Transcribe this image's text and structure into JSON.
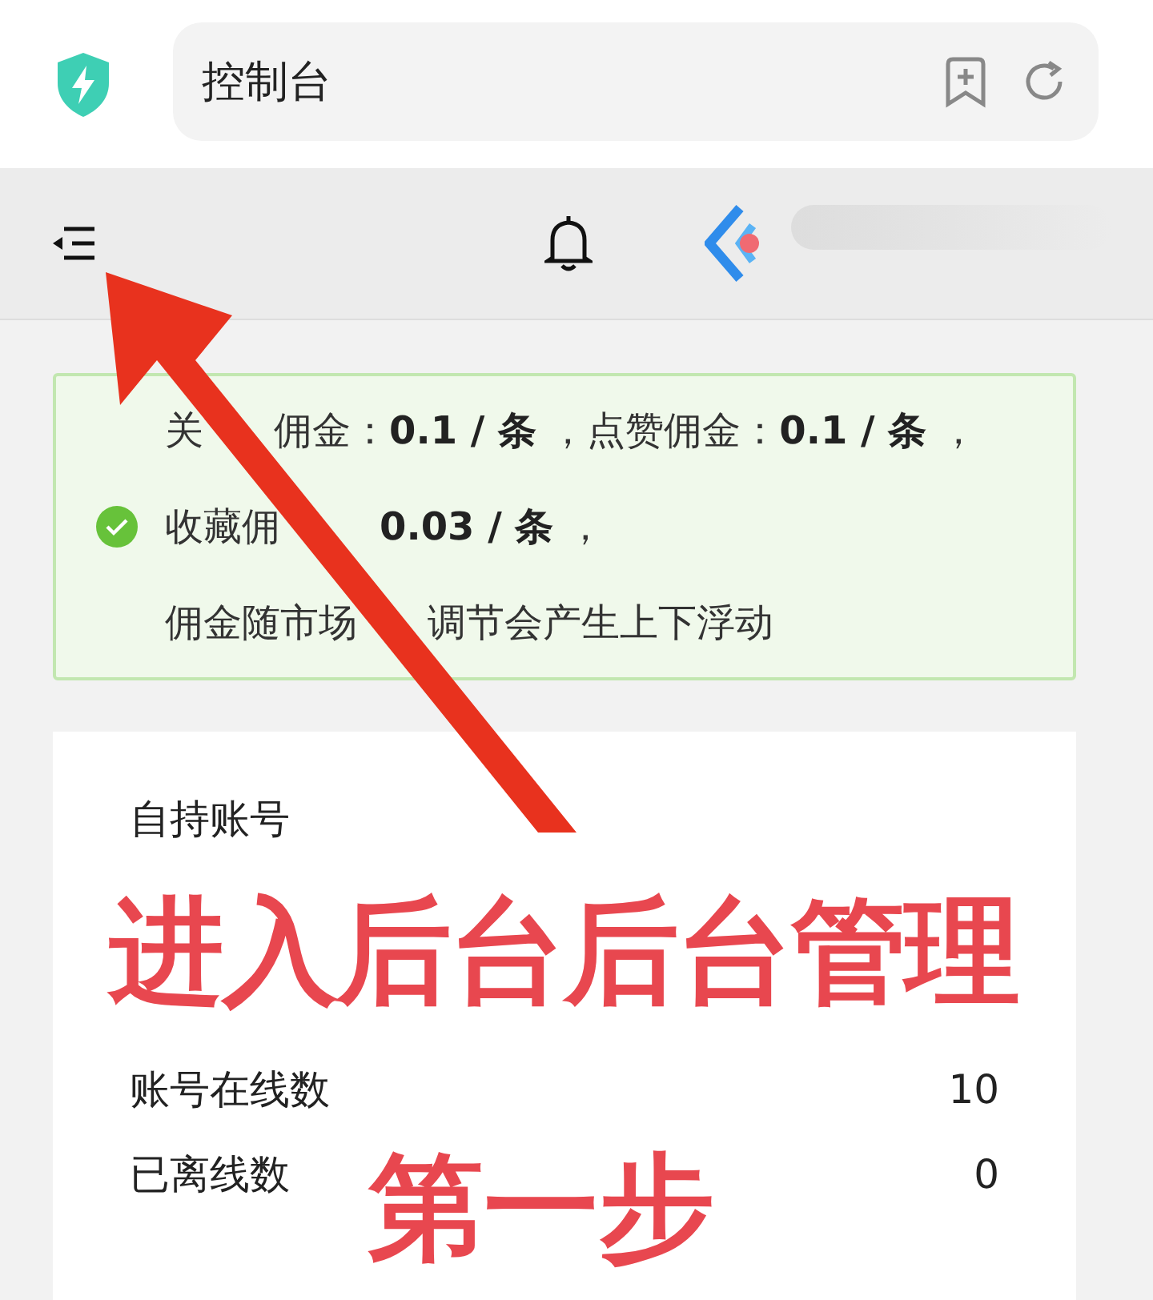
{
  "browser": {
    "address": "控制台"
  },
  "notice": {
    "kind": "success",
    "lines": [
      {
        "parts": [
          "关",
          "佣金：**0.1 / 条** ，点赞佣金：**0.1 / 条** ，"
        ]
      },
      {
        "parts": [
          "收藏佣",
          "**0.03 / 条** ，"
        ]
      },
      {
        "parts": [
          "佣金随市场",
          "调节会产生上下浮动"
        ]
      }
    ]
  },
  "card": {
    "title": "自持账号",
    "rows": [
      {
        "label": "账号在线数",
        "value": "10"
      },
      {
        "label": "已离线数",
        "value": "0"
      }
    ]
  },
  "annotations": {
    "headline": "进入后台后台管理",
    "step": "第一步"
  }
}
